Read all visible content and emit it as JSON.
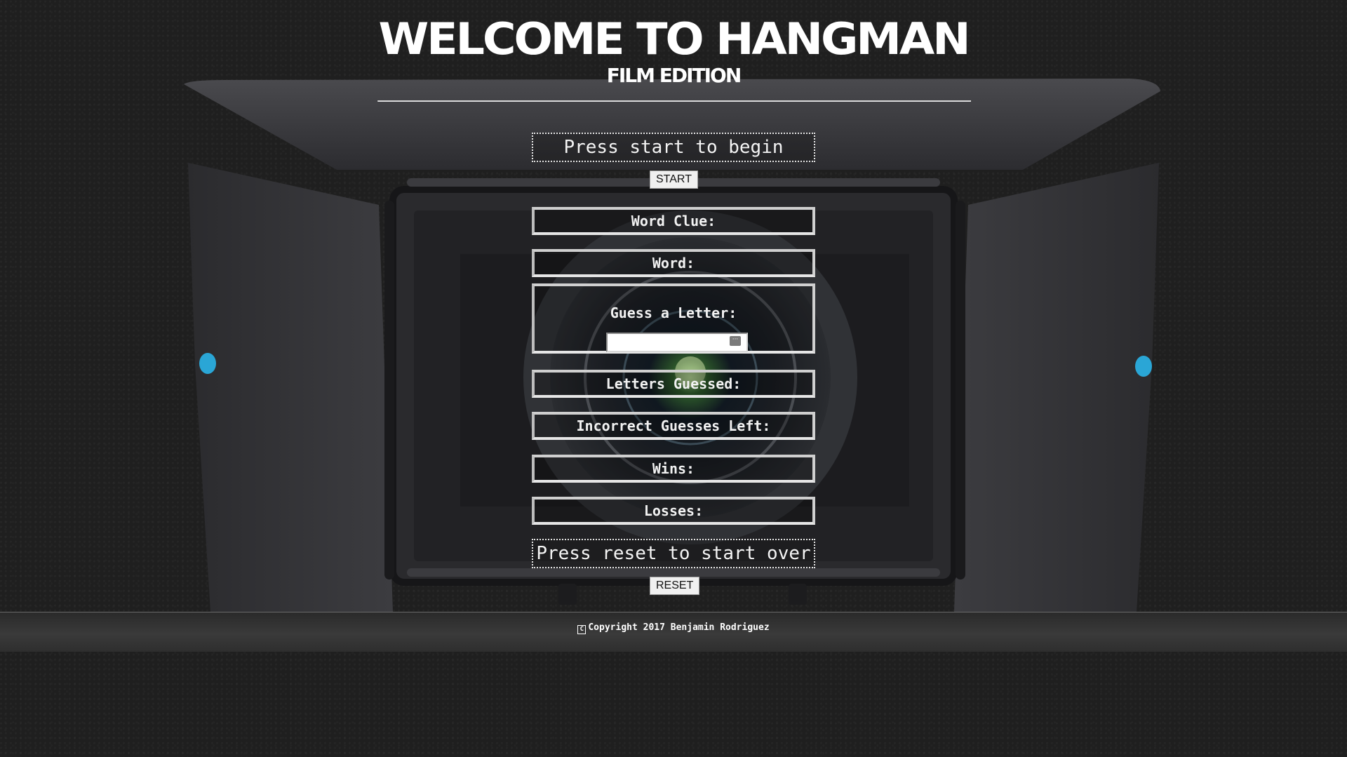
{
  "header": {
    "title": "Welcome to Hangman",
    "subtitle": "Film Edition"
  },
  "game": {
    "start_prompt": "Press start to begin",
    "start_button": "START",
    "word_clue_label": "Word Clue:",
    "word_label": "Word:",
    "guess_label": "Guess a Letter:",
    "guess_value": "",
    "letters_guessed_label": "Letters Guessed:",
    "incorrect_left_label": "Incorrect Guesses Left:",
    "wins_label": "Wins:",
    "losses_label": "Losses:",
    "reset_prompt": "Press reset to start over",
    "reset_button": "RESET"
  },
  "footer": {
    "copyright_symbol": "C",
    "text": "Copyright 2017 Benjamin Rodriguez"
  },
  "colors": {
    "page_background": "#1f1f1f",
    "text": "#ffffff",
    "lens_accent_blue": "#2aa6d6"
  },
  "icons": {
    "background_art": "camera-matte-box-icon",
    "input_badge": "password-manager-icon"
  }
}
